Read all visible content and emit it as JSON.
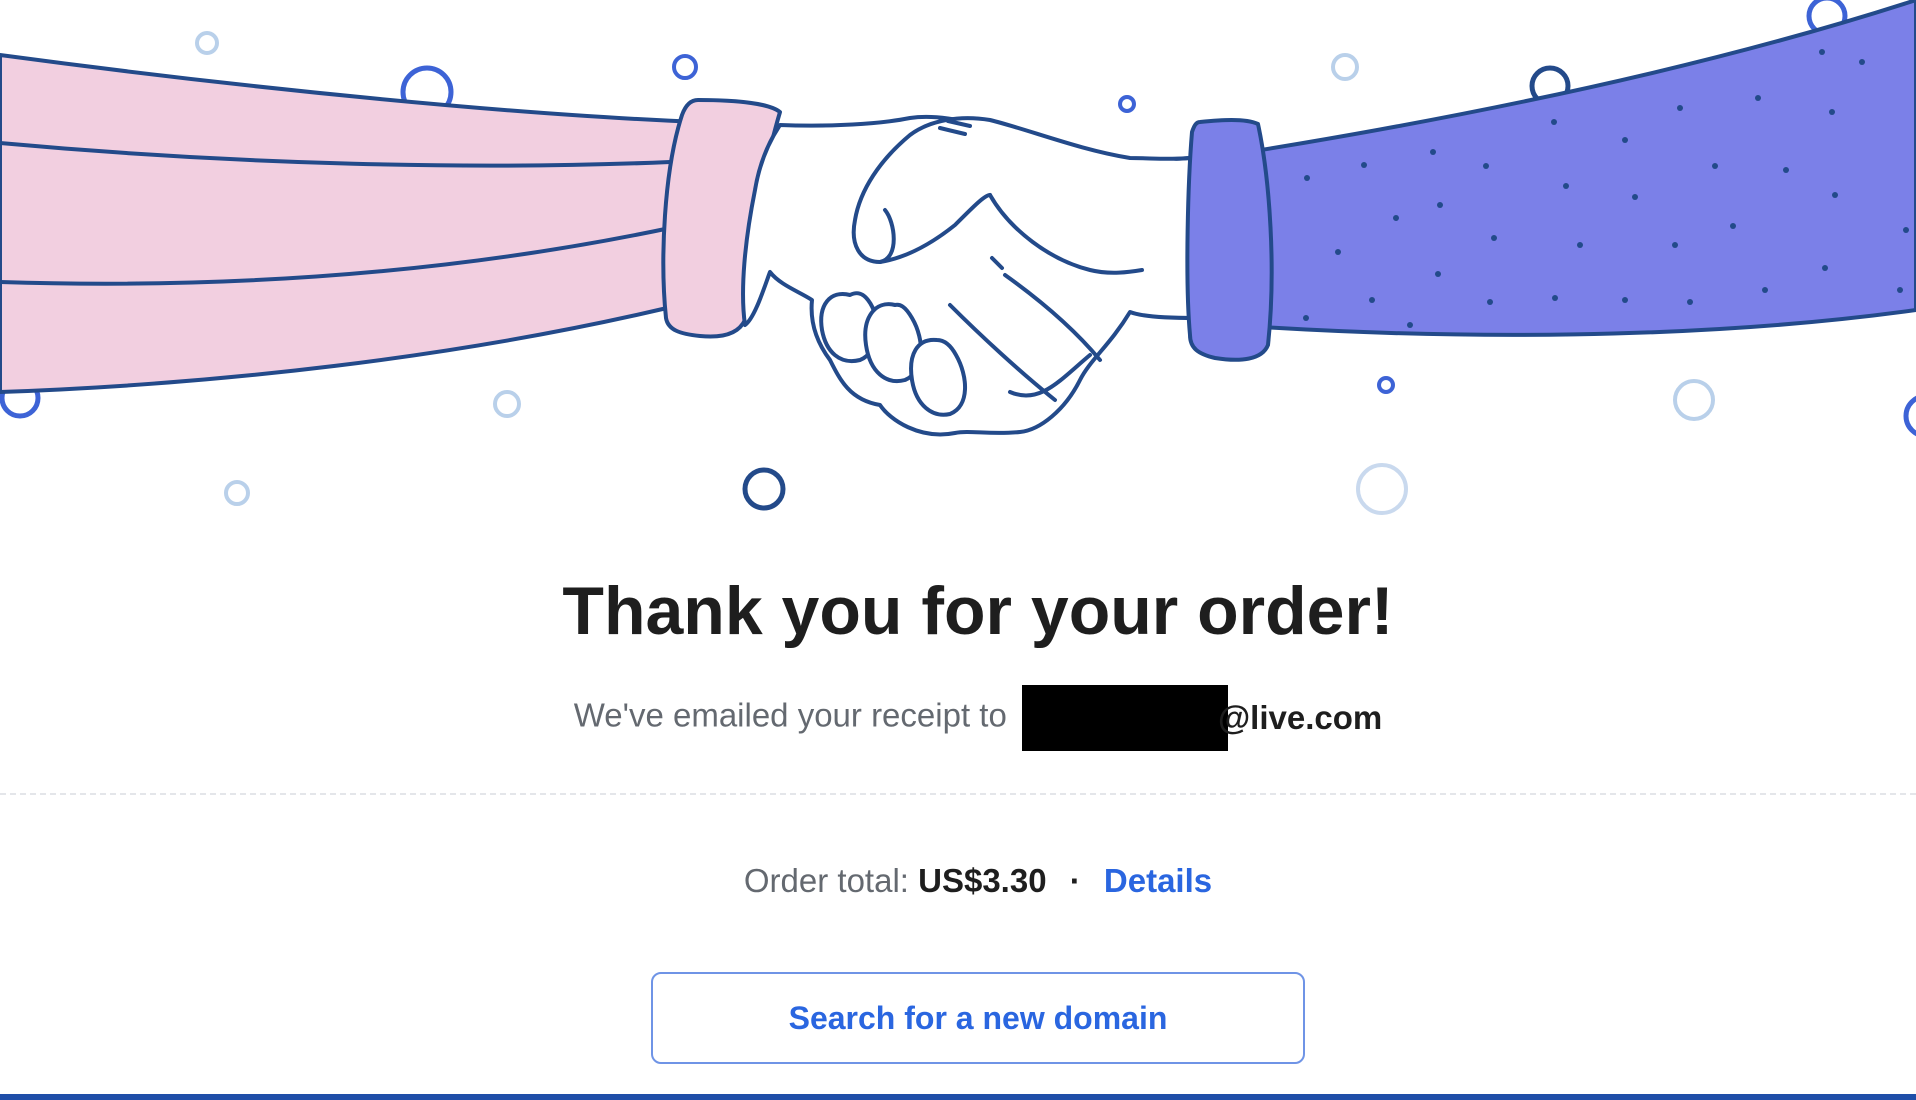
{
  "header": {
    "title": "Thank you for your order!"
  },
  "receipt": {
    "prefix": "We've emailed your receipt to",
    "email_domain": "@live.com"
  },
  "order": {
    "total_label": "Order total:",
    "total_amount": "US$3.30",
    "separator": "·",
    "details_link": "Details"
  },
  "actions": {
    "search_button_label": "Search for a new domain"
  },
  "colors": {
    "accent": "#2a66e0",
    "left_sleeve": "#f2cfe0",
    "right_sleeve": "#7b80e8",
    "outline": "#234a8a",
    "bottom_bar": "#1f4ea8"
  },
  "illustration": {
    "subject": "handshake-illustration"
  }
}
